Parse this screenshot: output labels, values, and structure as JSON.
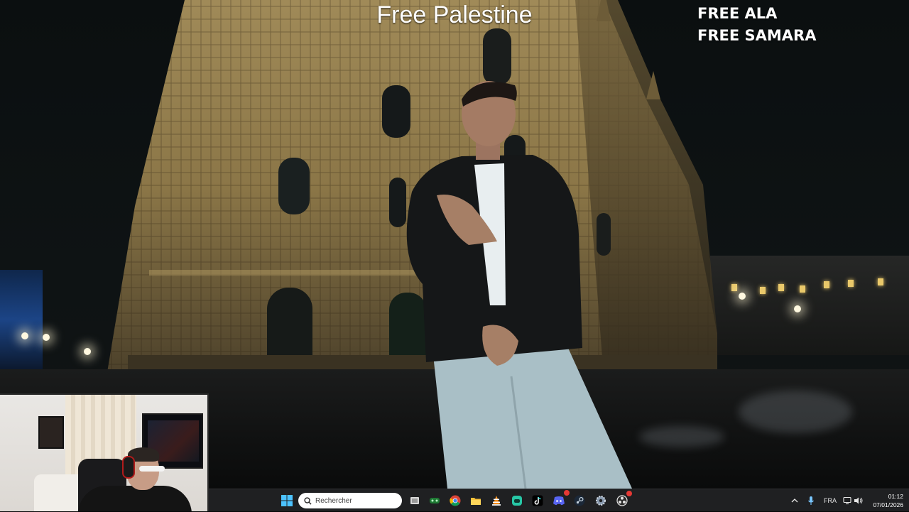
{
  "overlay": {
    "title": "Free Palestine",
    "lines": [
      "FREE ALA",
      "FREE SAMARA"
    ]
  },
  "taskbar": {
    "search_placeholder": "Rechercher",
    "apps": [
      {
        "name": "windows-start",
        "icon": "windows-logo-icon"
      },
      {
        "name": "task-view",
        "icon": "task-view-icon"
      },
      {
        "name": "xbox-app",
        "icon": "xbox-icon"
      },
      {
        "name": "chrome",
        "icon": "chrome-icon"
      },
      {
        "name": "file-explorer",
        "icon": "folder-icon"
      },
      {
        "name": "vlc",
        "icon": "vlc-cone-icon"
      },
      {
        "name": "xbox-game-bar",
        "icon": "gamebar-icon"
      },
      {
        "name": "tiktok",
        "icon": "tiktok-icon"
      },
      {
        "name": "discord",
        "icon": "discord-icon"
      },
      {
        "name": "steam",
        "icon": "steam-icon"
      },
      {
        "name": "settings",
        "icon": "gear-icon"
      },
      {
        "name": "obs",
        "icon": "obs-record-icon"
      }
    ],
    "tray": {
      "language": "FRA",
      "time": "01:12",
      "date": "07/01/2026"
    },
    "colors": {
      "taskbar_bg": "#1f2022",
      "accent_blue": "#0078d4"
    }
  }
}
